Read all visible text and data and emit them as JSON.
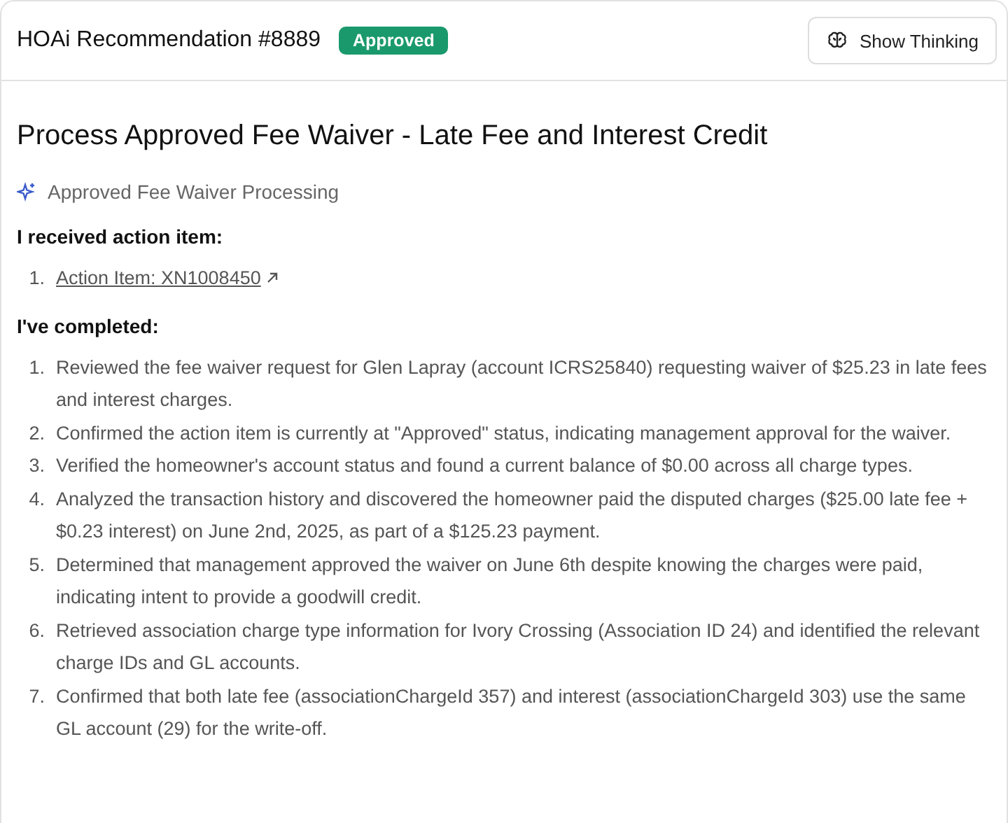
{
  "header": {
    "title": "HOAi Recommendation #8889",
    "badge": {
      "label": "Approved",
      "kind": "approved"
    },
    "button": "Show Thinking"
  },
  "heading": "Process Approved Fee Waiver - Late Fee and Interest Credit",
  "subtitle": "Approved Fee Waiver Processing",
  "sections": [
    {
      "title": "I received action item:",
      "items": [
        {
          "number": "1.",
          "kind": "link",
          "text": "Action Item: XN1008450"
        }
      ]
    },
    {
      "title": "I've completed:",
      "items": [
        {
          "number": "1.",
          "kind": "text",
          "text": "Reviewed the fee waiver request for Glen Lapray (account ICRS25840) requesting waiver of $25.23 in late fees and interest charges."
        },
        {
          "number": "2.",
          "kind": "text",
          "text": "Confirmed the action item is currently at \"Approved\" status, indicating management approval for the waiver."
        },
        {
          "number": "3.",
          "kind": "text",
          "text": "Verified the homeowner's account status and found a current balance of $0.00 across all charge types."
        },
        {
          "number": "4.",
          "kind": "text",
          "text": "Analyzed the transaction history and discovered the homeowner paid the disputed charges ($25.00 late fee + $0.23 interest) on June 2nd, 2025, as part of a $125.23 payment."
        },
        {
          "number": "5.",
          "kind": "text",
          "text": "Determined that management approved the waiver on June 6th despite knowing the charges were paid, indicating intent to provide a goodwill credit."
        },
        {
          "number": "6.",
          "kind": "text",
          "text": "Retrieved association charge type information for Ivory Crossing (Association ID 24) and identified the relevant charge IDs and GL accounts."
        },
        {
          "number": "7.",
          "kind": "text",
          "text": "Confirmed that both late fee (associationChargeId 357) and interest (associationChargeId 303) use the same GL account (29) for the write-off."
        }
      ]
    }
  ]
}
